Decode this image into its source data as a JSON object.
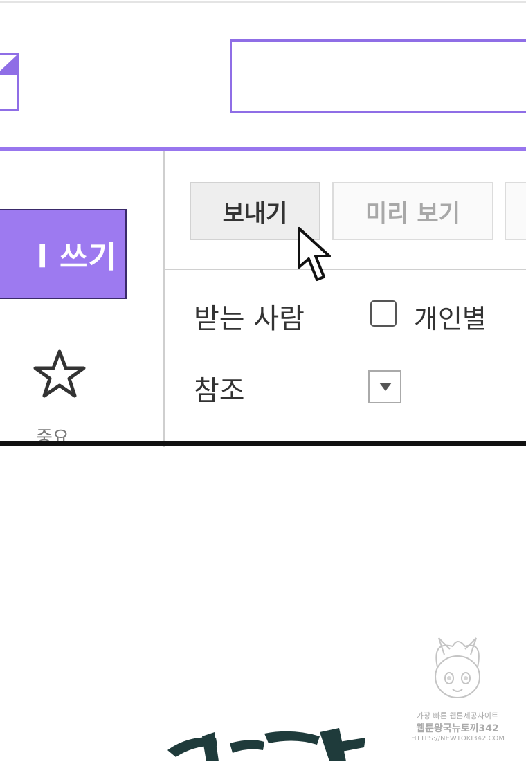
{
  "toolbar": {
    "send_label": "보내기",
    "preview_label": "미리 보기"
  },
  "sidebar": {
    "compose_label": "l 쓰기",
    "important_label": "중요"
  },
  "header_fields": {
    "recipient_label": "받는 사람",
    "individual_label": "개인별",
    "individual_checked": false,
    "cc_label": "참조"
  },
  "watermark": {
    "line1": "가장 빠른 웹툰제공사이트",
    "line2": "웹툰왕국뉴토끼342",
    "line3": "HTTPS://NEWTOKI342.COM"
  },
  "colors": {
    "accent": "#9876ee",
    "compose_bg": "#9d7af0",
    "rule": "#111111"
  },
  "icons": [
    "star-icon",
    "dropdown-arrow-icon",
    "mouse-cursor-icon",
    "checkbox-icon"
  ]
}
